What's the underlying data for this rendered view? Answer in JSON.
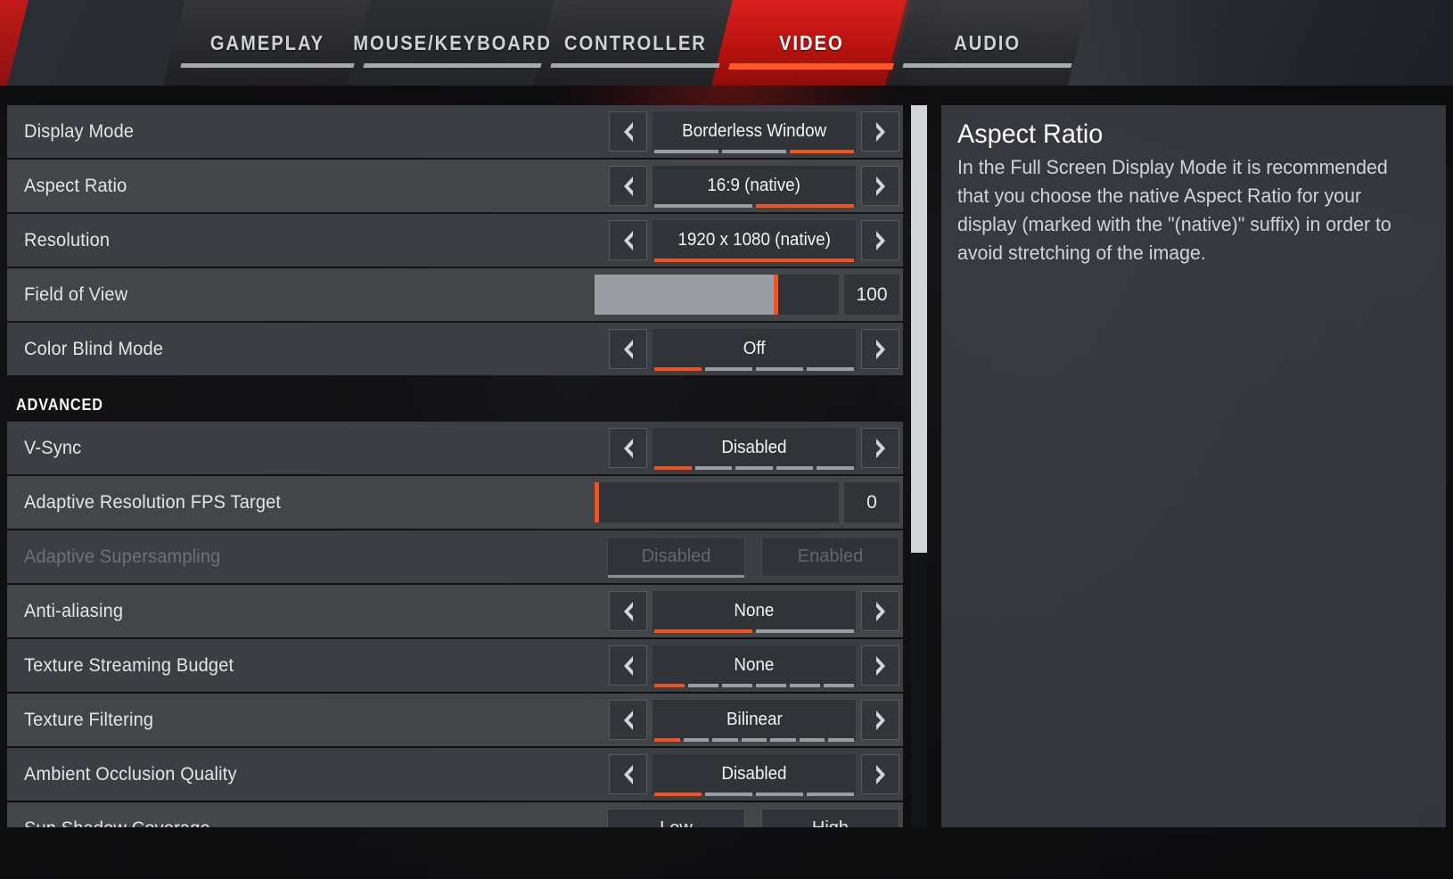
{
  "tabs": [
    {
      "label": "GAMEPLAY",
      "active": false
    },
    {
      "label": "MOUSE/KEYBOARD",
      "active": false
    },
    {
      "label": "CONTROLLER",
      "active": false
    },
    {
      "label": "VIDEO",
      "active": true
    },
    {
      "label": "AUDIO",
      "active": false
    }
  ],
  "colors": {
    "accent_orange": "#f4511e",
    "tab_active_red": "#c21b18",
    "row_bg": "#3b3e43",
    "row_bg_alt": "#434649",
    "scrollbar_thumb": "#d3d6d9"
  },
  "settings": [
    {
      "type": "selector",
      "label": "Display Mode",
      "value": "Borderless Window",
      "segments": 3,
      "active_segment": 3,
      "disabled": false
    },
    {
      "type": "selector",
      "label": "Aspect Ratio",
      "value": "16:9 (native)",
      "segments": 2,
      "active_segment": 2,
      "disabled": false
    },
    {
      "type": "selector",
      "label": "Resolution",
      "value": "1920 x 1080 (native)",
      "segments": 1,
      "active_segment": 1,
      "disabled": false
    },
    {
      "type": "slider",
      "label": "Field of View",
      "value": "100",
      "fill_percent": 74,
      "disabled": false
    },
    {
      "type": "selector",
      "label": "Color Blind Mode",
      "value": "Off",
      "segments": 4,
      "active_segment": 1,
      "disabled": false
    },
    {
      "type": "section",
      "label": "ADVANCED"
    },
    {
      "type": "selector",
      "label": "V-Sync",
      "value": "Disabled",
      "segments": 5,
      "active_segment": 1,
      "disabled": false
    },
    {
      "type": "slider",
      "label": "Adaptive Resolution FPS Target",
      "value": "0",
      "fill_percent": 0,
      "disabled": false
    },
    {
      "type": "toggle",
      "label": "Adaptive Supersampling",
      "options": [
        "Disabled",
        "Enabled"
      ],
      "selected_index": 0,
      "disabled": true
    },
    {
      "type": "selector",
      "label": "Anti-aliasing",
      "value": "None",
      "segments": 2,
      "active_segment": 1,
      "disabled": false
    },
    {
      "type": "selector",
      "label": "Texture Streaming Budget",
      "value": "None",
      "segments": 6,
      "active_segment": 1,
      "disabled": false
    },
    {
      "type": "selector",
      "label": "Texture Filtering",
      "value": "Bilinear",
      "segments": 7,
      "active_segment": 1,
      "disabled": false
    },
    {
      "type": "selector",
      "label": "Ambient Occlusion Quality",
      "value": "Disabled",
      "segments": 4,
      "active_segment": 1,
      "disabled": false
    },
    {
      "type": "toggle",
      "label": "Sun Shadow Coverage",
      "options": [
        "Low",
        "High"
      ],
      "selected_index": -1,
      "disabled": false
    }
  ],
  "description": {
    "title": "Aspect Ratio",
    "body": "In the Full Screen Display Mode it is recommended that you choose the native Aspect Ratio for your display (marked with the \"(native)\" suffix) in order to avoid stretching of the image."
  },
  "scrollbar": {
    "thumb_top_percent": 0,
    "thumb_height_percent": 62
  },
  "icons": {
    "left_arrow": "chevron-left-icon",
    "right_arrow": "chevron-right-icon"
  }
}
